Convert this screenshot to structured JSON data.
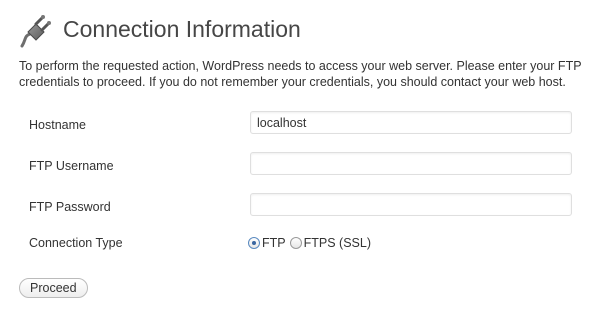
{
  "page_title": "Connection Information",
  "intro_text": "To perform the requested action, WordPress needs to access your web server. Please enter your FTP credentials to proceed. If you do not remember your credentials, you should contact your web host.",
  "form": {
    "hostname": {
      "label": "Hostname",
      "value": "localhost"
    },
    "ftp_username": {
      "label": "FTP Username",
      "value": ""
    },
    "ftp_password": {
      "label": "FTP Password",
      "value": ""
    },
    "connection_type": {
      "label": "Connection Type",
      "options": [
        {
          "label": "FTP",
          "checked": true
        },
        {
          "label": "FTPS (SSL)",
          "checked": false
        }
      ]
    }
  },
  "proceed_label": "Proceed",
  "icons": {
    "header": "plug-icon"
  }
}
